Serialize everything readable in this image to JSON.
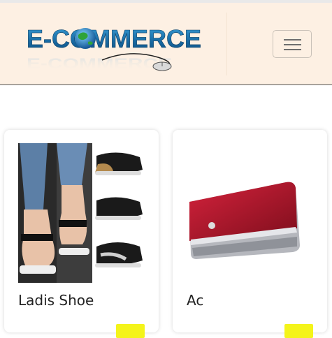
{
  "header": {
    "logo_text": "E-COMMERCE",
    "menu_icon": "hamburger-menu-icon"
  },
  "products": [
    {
      "title": "Ladis Shoe",
      "image": "sandals-photo"
    },
    {
      "title": "Ac",
      "image": "air-conditioner-photo"
    }
  ],
  "colors": {
    "navbar_bg": "#fdf0e3",
    "logo_blue": "#1f7eb5",
    "badge_yellow": "#f4f41a",
    "ac_red": "#b01428"
  }
}
